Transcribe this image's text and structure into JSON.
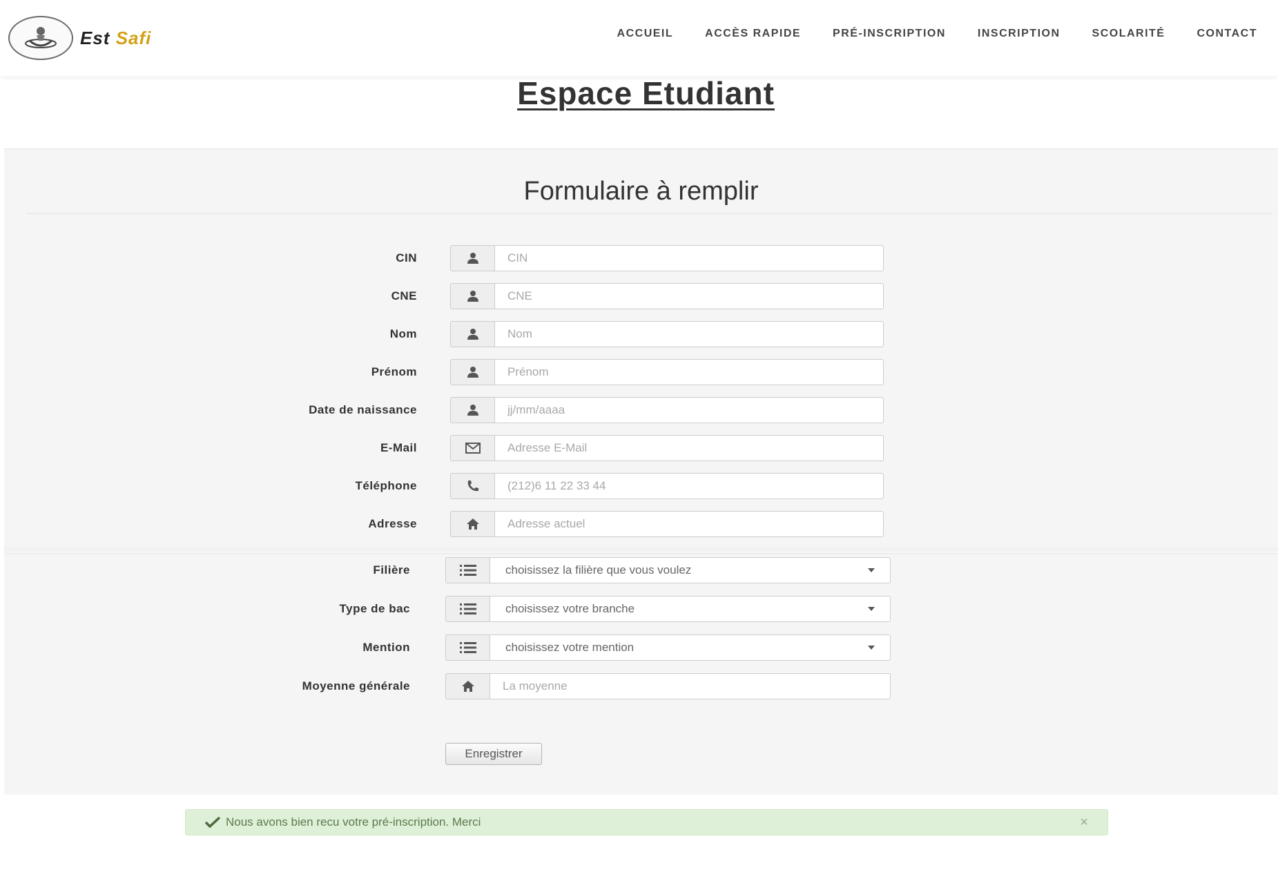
{
  "header": {
    "logo_text_main": "Est ",
    "logo_text_accent": "Safi",
    "nav": [
      {
        "label": "ACCUEIL"
      },
      {
        "label": "ACCÈS RAPIDE"
      },
      {
        "label": "PRÉ-INSCRIPTION"
      },
      {
        "label": "INSCRIPTION"
      },
      {
        "label": "SCOLARITÉ"
      },
      {
        "label": "CONTACT"
      }
    ]
  },
  "page": {
    "title": "Espace Etudiant"
  },
  "form": {
    "title": "Formulaire à remplir",
    "fields": [
      {
        "label": "CIN",
        "placeholder": "CIN",
        "icon": "user-icon",
        "value": ""
      },
      {
        "label": "CNE",
        "placeholder": "CNE",
        "icon": "user-icon",
        "value": ""
      },
      {
        "label": "Nom",
        "placeholder": "Nom",
        "icon": "user-icon",
        "value": ""
      },
      {
        "label": "Prénom",
        "placeholder": "Prénom",
        "icon": "user-icon",
        "value": ""
      },
      {
        "label": "Date de naissance",
        "placeholder": "jj/mm/aaaa",
        "icon": "user-icon",
        "value": ""
      },
      {
        "label": "E-Mail",
        "placeholder": "Adresse E-Mail",
        "icon": "envelope-icon",
        "value": ""
      },
      {
        "label": "Téléphone",
        "placeholder": "(212)6 11 22 33 44",
        "icon": "phone-icon",
        "value": ""
      },
      {
        "label": "Adresse",
        "placeholder": "Adresse actuel",
        "icon": "home-icon",
        "value": ""
      }
    ],
    "selects": [
      {
        "label": "Filière",
        "selected": "choisissez la filière que vous voulez",
        "icon": "list-icon"
      },
      {
        "label": "Type de bac",
        "selected": "choisissez votre branche",
        "icon": "list-icon"
      },
      {
        "label": "Mention",
        "selected": "choisissez votre mention",
        "icon": "list-icon"
      }
    ],
    "average": {
      "label": "Moyenne générale",
      "placeholder": "La moyenne",
      "icon": "home-icon",
      "value": ""
    },
    "submit_label": "Enregistrer"
  },
  "alert": {
    "message": "Nous avons bien recu votre pré-inscription. Merci",
    "close_glyph": "×",
    "color": "#dff0d8"
  }
}
